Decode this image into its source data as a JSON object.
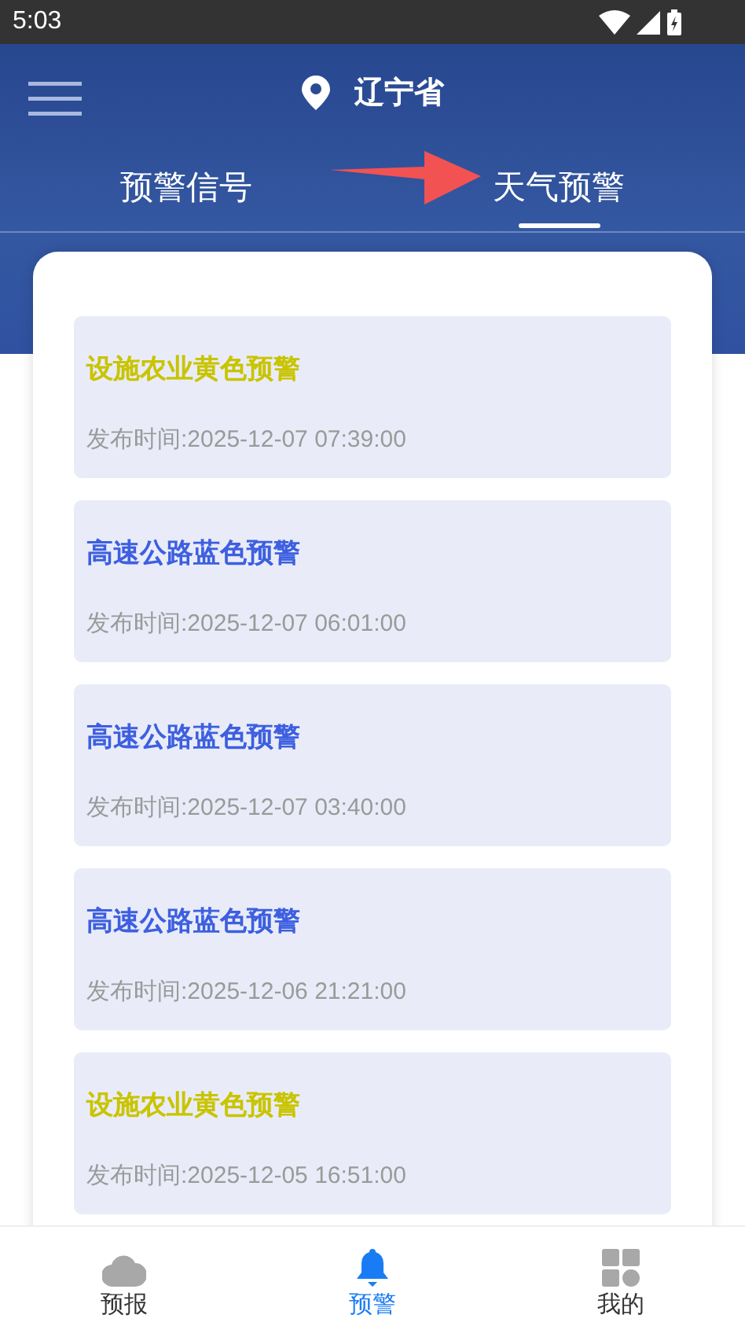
{
  "status_bar": {
    "time": "5:03"
  },
  "header": {
    "location": "辽宁省"
  },
  "tabs": [
    {
      "label": "预警信号",
      "selected": false
    },
    {
      "label": "天气预警",
      "selected": true
    }
  ],
  "warnings": [
    {
      "title": "设施农业黄色预警",
      "color": "#c9c400",
      "time": "发布时间:2025-12-07 07:39:00"
    },
    {
      "title": "高速公路蓝色预警",
      "color": "#3d5fe0",
      "time": "发布时间:2025-12-07 06:01:00"
    },
    {
      "title": "高速公路蓝色预警",
      "color": "#3d5fe0",
      "time": "发布时间:2025-12-07 03:40:00"
    },
    {
      "title": "高速公路蓝色预警",
      "color": "#3d5fe0",
      "time": "发布时间:2025-12-06 21:21:00"
    },
    {
      "title": "设施农业黄色预警",
      "color": "#c9c400",
      "time": "发布时间:2025-12-05 16:51:00"
    }
  ],
  "bottom_nav": [
    {
      "label": "预报",
      "selected": false
    },
    {
      "label": "预警",
      "selected": true
    },
    {
      "label": "我的",
      "selected": false
    }
  ]
}
